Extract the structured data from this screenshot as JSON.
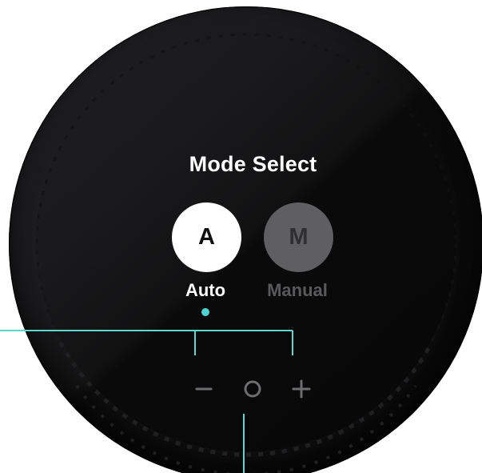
{
  "panel": {
    "title": "Mode Select",
    "selected_mode": "Auto"
  },
  "modes": [
    {
      "icon": "A",
      "label": "Auto",
      "selected": true,
      "color": "#ffffff"
    },
    {
      "icon": "M",
      "label": "Manual",
      "selected": false,
      "color": "#5f5f61"
    }
  ],
  "controls": {
    "minus_icon": "minus-icon",
    "center_icon": "circle-icon",
    "plus_icon": "plus-icon",
    "control_color": "#6d6d70"
  },
  "colors": {
    "accent": "#4fd2d2",
    "dial": "#0b0b0c",
    "selected_text": "#ffffff",
    "inactive_text": "#59595b"
  }
}
